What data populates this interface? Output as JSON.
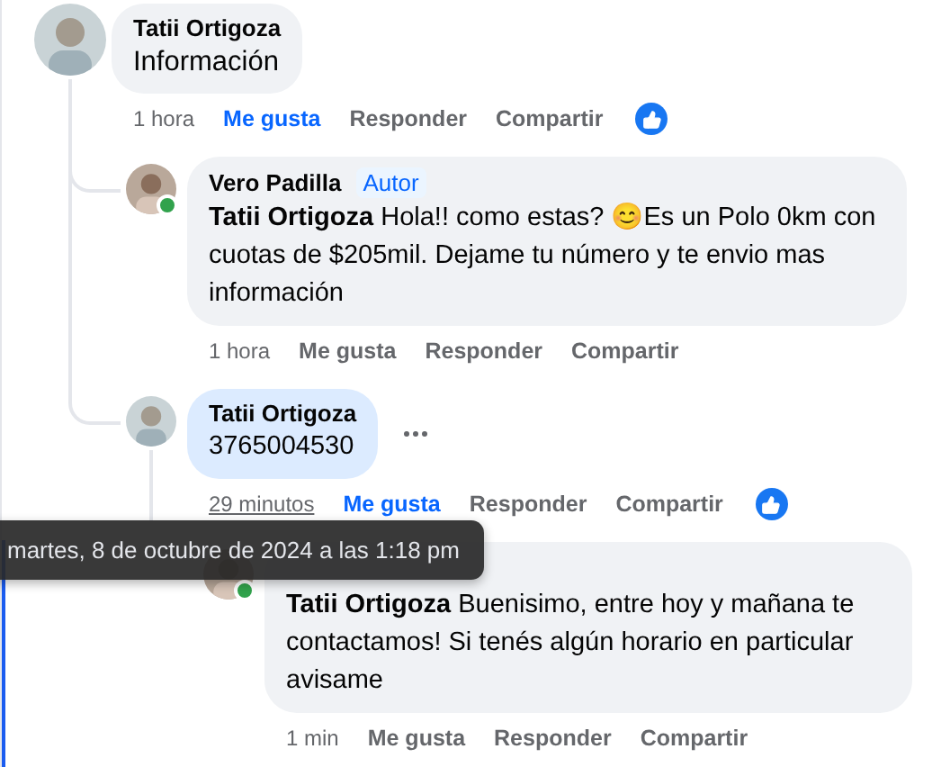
{
  "comments": [
    {
      "author": "Tatii Ortigoza",
      "text": "Información",
      "time": "1 hora",
      "actions": [
        "Me gusta",
        "Responder",
        "Compartir"
      ],
      "liked": true,
      "replies": [
        {
          "author": "Vero Padilla",
          "badge": "Autor",
          "text": "**Tatii Ortigoza** Hola!! como estas? 😊Es un Polo 0km con cuotas de $205mil. Dejame tu número y te envio mas información",
          "time": "1 hora",
          "actions": [
            "Me gusta",
            "Responder",
            "Compartir"
          ],
          "liked": false,
          "online": true
        },
        {
          "author": "Tatii Ortigoza",
          "text": "3765004530",
          "time": "29 minutos",
          "time_tooltip": "martes, 8 de octubre de 2024 a las 1:18 pm",
          "actions": [
            "Me gusta",
            "Responder",
            "Compartir"
          ],
          "liked": true,
          "highlighted": true,
          "replies": [
            {
              "text": "**Tatii Ortigoza** Buenisimo, entre hoy y mañana te contactamos! Si tenés algún horario en particular avisame",
              "time": "1 min",
              "actions": [
                "Me gusta",
                "Responder",
                "Compartir"
              ],
              "liked": false,
              "online": true
            }
          ]
        }
      ]
    }
  ]
}
